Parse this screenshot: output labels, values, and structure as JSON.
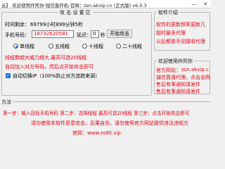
{
  "window": {
    "title": "云】 欢迎使用炸死你-短信轰炸机-官网：zsn.akvip.cn (正式版) v6.0.3",
    "minimize_glyph": "—",
    "close_glyph": "✕"
  },
  "attack": {
    "legend": "攻 击 设 置 区",
    "time_label": "时间剩余：",
    "time_value": "69799小时899分钟5秒",
    "phone_label": "手机号码：",
    "phone_value": "18732620581",
    "delay_label": "延迟：",
    "delay_value": "0",
    "delay_unit": "秒",
    "start_button": "开始攻击",
    "rounds": [
      {
        "label": "单线程",
        "selected": true
      },
      {
        "label": "五线程",
        "selected": false
      },
      {
        "label": "十线程",
        "selected": false
      },
      {
        "label": "二十线程",
        "selected": false
      }
    ],
    "warn_line1": "线程数越大威力越大,最高可选20线程",
    "warn_line2": "自动加入对方号码，然后点开始攻击即可",
    "auto_ip_label": "自动切换IP（100%防止对方追踪来源）"
  },
  "notice": {
    "legend": "软件介绍",
    "lines": [
      "软件的更新频率更新几",
      "超时最多代理",
      "以后都是手动接收代理"
    ]
  },
  "welcome": {
    "legend": "欢迎使用炸死你",
    "site_label": "官方网站：",
    "site_value": "zsn.akvip.c",
    "lines": [
      "诚信靠谱代理，点击会购",
      "售后有事通知请发件",
      "售后有事通知请发件"
    ]
  },
  "method": {
    "legend": "方法",
    "steps": "第一步：输入目标手机号码  第二步：选择线程 最高可选20线程  第三步：点击开始攻击即可",
    "tip": "请勿使用本软件恶意攻击，后果自负。请勿使用官方网站提供违法违规方",
    "site": "官网：www.zs80.vip"
  },
  "colors": {
    "accent_red": "#e60012",
    "accent_blue": "#1a73e8"
  }
}
